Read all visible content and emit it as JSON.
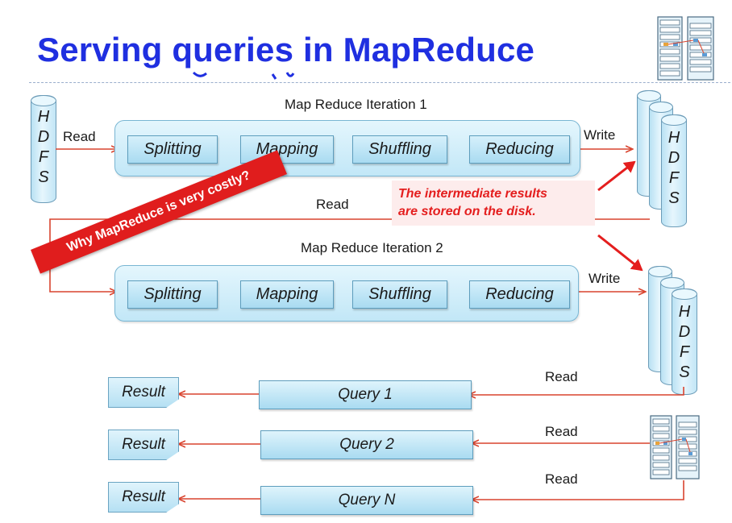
{
  "title": "Serving queries in MapReduce",
  "hdfs_letters": [
    "H",
    "D",
    "F",
    "S"
  ],
  "iteration1": {
    "title": "Map Reduce Iteration 1",
    "steps": [
      "Splitting",
      "Mapping",
      "Shuffling",
      "Reducing"
    ],
    "read_label": "Read",
    "write_label": "Write"
  },
  "iteration2": {
    "title": "Map Reduce Iteration 2",
    "steps": [
      "Splitting",
      "Mapping",
      "Shuffling",
      "Reducing"
    ],
    "read_label": "Read",
    "write_label": "Write"
  },
  "callout": {
    "line1": "The intermediate results",
    "line2": "are stored on the disk."
  },
  "banner": "Why MapReduce is very costly?",
  "queries": [
    {
      "label": "Query 1",
      "result": "Result",
      "read_label": "Read"
    },
    {
      "label": "Query 2",
      "result": "Result",
      "read_label": "Read"
    },
    {
      "label": "Query N",
      "result": "Result",
      "read_label": "Read"
    }
  ],
  "rack_label": "rack",
  "rack_top_label": "node",
  "colors": {
    "title": "#1f2fe0",
    "arrow": "#d9442f",
    "alert": "#e41e1e",
    "box_fill": "#c2e7f7"
  }
}
